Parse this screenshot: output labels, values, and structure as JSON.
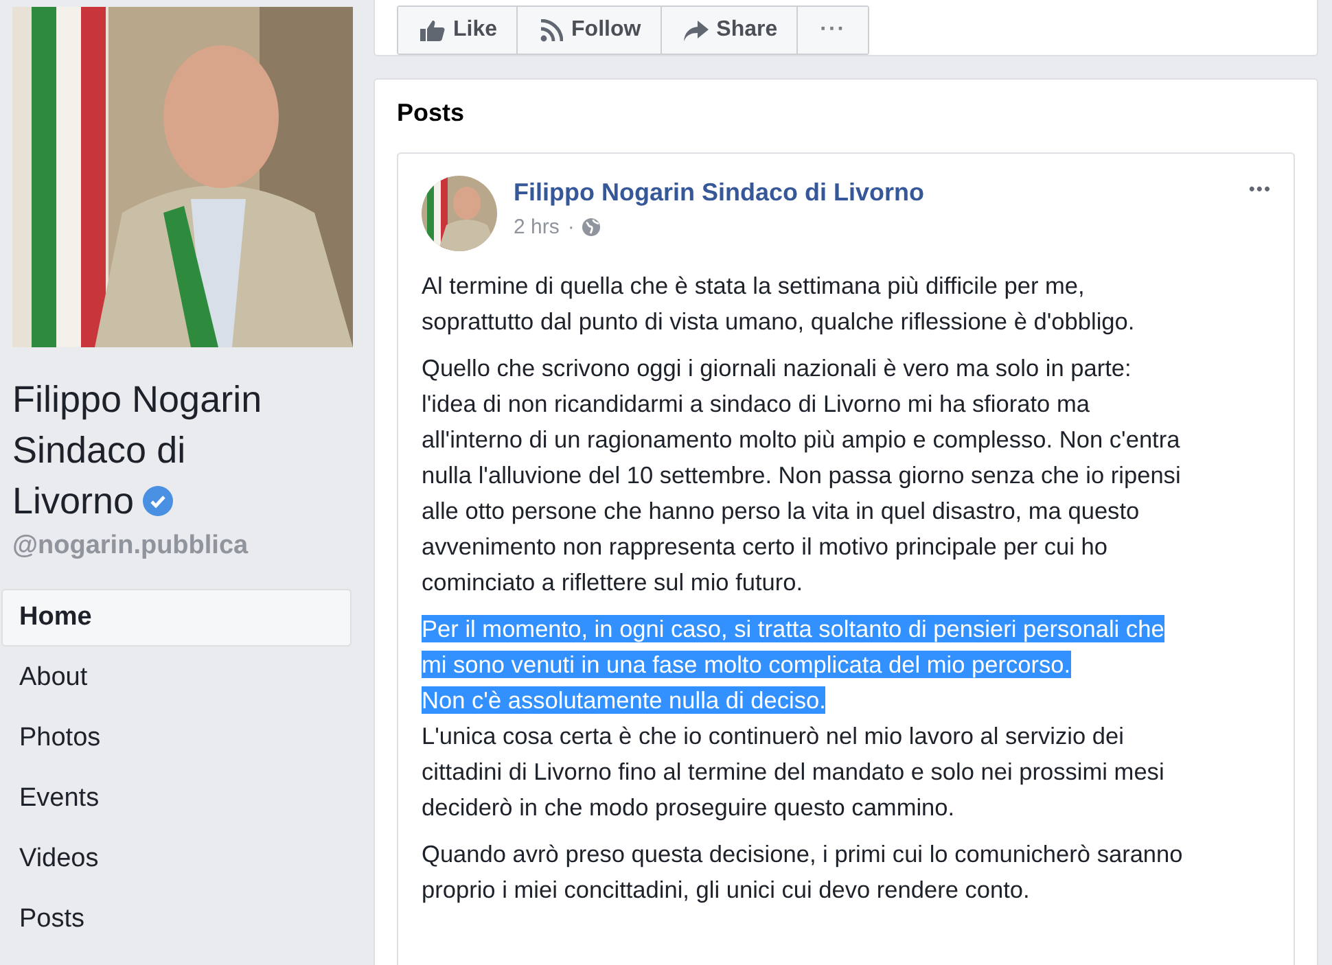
{
  "sidebar": {
    "page_name": "Filippo Nogarin Sindaco di Livorno",
    "verified": true,
    "handle": "@nogarin.pubblica",
    "nav": [
      {
        "label": "Home",
        "selected": true
      },
      {
        "label": "About",
        "selected": false
      },
      {
        "label": "Photos",
        "selected": false
      },
      {
        "label": "Events",
        "selected": false
      },
      {
        "label": "Videos",
        "selected": false
      },
      {
        "label": "Posts",
        "selected": false
      }
    ]
  },
  "actions": [
    {
      "kind": "like",
      "label": "Like"
    },
    {
      "kind": "follow",
      "label": "Follow"
    },
    {
      "kind": "share",
      "label": "Share"
    },
    {
      "kind": "more",
      "label": "···"
    }
  ],
  "posts_section": {
    "title": "Posts",
    "post": {
      "author": "Filippo Nogarin Sindaco di Livorno",
      "time": "2 hrs",
      "separator": "·",
      "menu": "•••",
      "paragraphs": [
        {
          "lines": [
            {
              "text": "Al termine di quella che è stata la settimana più difficile per me,",
              "selected": false
            },
            {
              "text": "soprattutto dal punto di vista umano, qualche riflessione è d'obbligo.",
              "selected": false
            }
          ]
        },
        {
          "lines": [
            {
              "text": "Quello che scrivono oggi i giornali nazionali è vero ma solo in parte:",
              "selected": false
            },
            {
              "text": "l'idea di non ricandidarmi a sindaco di Livorno mi ha sfiorato ma",
              "selected": false
            },
            {
              "text": "all'interno di un ragionamento molto più ampio e complesso. Non c'entra",
              "selected": false
            },
            {
              "text": "nulla l'alluvione del 10 settembre. Non passa giorno senza che io ripensi",
              "selected": false
            },
            {
              "text": "alle otto persone che hanno perso la vita in quel disastro, ma questo",
              "selected": false
            },
            {
              "text": "avvenimento non rappresenta certo il motivo principale per cui ho",
              "selected": false
            },
            {
              "text": "cominciato a riflettere sul mio futuro.",
              "selected": false
            }
          ]
        },
        {
          "lines": [
            {
              "text": "Per il momento, in ogni caso, si tratta soltanto di pensieri personali che",
              "selected": true
            },
            {
              "text": "mi sono venuti in una fase molto complicata del mio percorso.",
              "selected": true
            },
            {
              "text": "Non c'è assolutamente nulla di deciso.",
              "selected": true
            },
            {
              "text": "L'unica cosa certa è che io continuerò nel mio lavoro al servizio dei",
              "selected": false
            },
            {
              "text": "cittadini di Livorno fino al termine del mandato e solo nei prossimi mesi",
              "selected": false
            },
            {
              "text": "deciderò in che modo proseguire questo cammino.",
              "selected": false
            }
          ]
        },
        {
          "lines": [
            {
              "text": "Quando avrò preso questa decisione, i primi cui lo comunicherò saranno",
              "selected": false
            },
            {
              "text": "proprio i miei concittadini, gli unici cui devo rendere conto.",
              "selected": false
            }
          ]
        }
      ]
    }
  }
}
